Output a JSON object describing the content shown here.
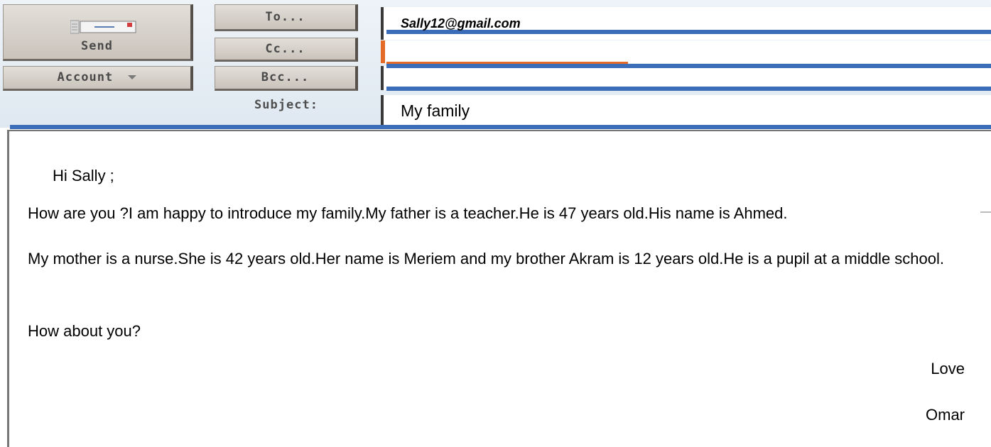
{
  "toolbar": {
    "send_label": "Send",
    "send_icon": "envelope-send-icon",
    "account_label": "Account",
    "account_icon": "dropdown-arrow-icon"
  },
  "address": {
    "to_label": "To...",
    "cc_label": "Cc...",
    "bcc_label": "Bcc...",
    "subject_label": "Subject:",
    "to_value": "Sally12@gmail.com",
    "cc_value": "",
    "bcc_value": "",
    "subject_value": "My family"
  },
  "message": {
    "greeting": "Hi Sally ;",
    "paragraphs": [
      "How are you ?I am happy to introduce my family.My father is a teacher.He is 47 years old.His name is Ahmed.",
      "My mother is a nurse.She is 42 years old.Her name is Meriem and my brother Akram is 12 years old.He is a pupil at a middle school.",
      "How about you?"
    ],
    "closing": "Love",
    "signature": "Omar"
  },
  "colors": {
    "accent_line": "#3c6db8",
    "cc_marker": "#e36b27",
    "header_bg": "#e6edf4",
    "button_face": "#d6d1ca"
  }
}
